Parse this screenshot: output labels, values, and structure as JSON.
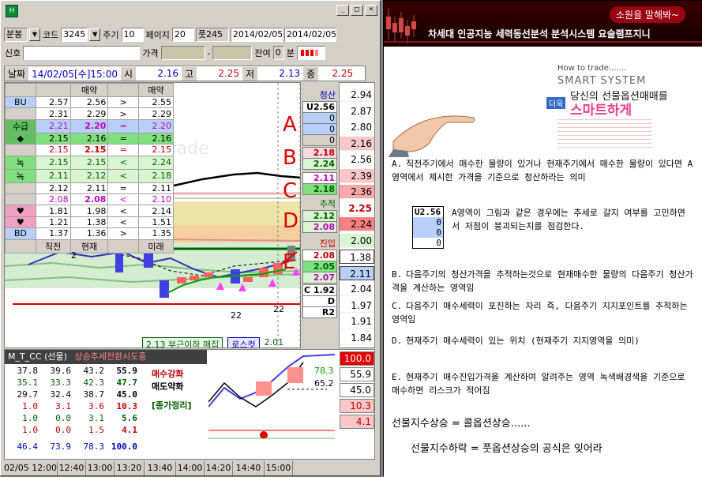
{
  "window": {
    "sys_icon": "H"
  },
  "toolbar": {
    "period_type": "분봉",
    "code_label": "코드",
    "code_value": "3245",
    "cycle_label": "주기",
    "cycle_value": "10",
    "page_label": "페이지",
    "page_value": "20",
    "extra_value": "풋245",
    "date_from": "2014/02/05",
    "date_to": "2014/02/05",
    "signal_label": "신호",
    "price_label": "가격",
    "remain_label": "잔여",
    "remain_value": "0",
    "min_label": "분"
  },
  "quote": {
    "date_label": "날짜",
    "date": "14/02/05[수]15:00",
    "open_label": "시",
    "open": "2.16",
    "high_label": "고",
    "high": "2.25",
    "low_label": "저",
    "low": "2.13",
    "close_label": "종",
    "close": "2.25"
  },
  "orderbook": {
    "header": [
      "",
      "매약",
      "",
      "매약"
    ],
    "rows": [
      {
        "label": "BU",
        "a": "2.57",
        "b": "2.56",
        "s": ">",
        "c": "2.55"
      },
      {
        "label": "",
        "a": "2.31",
        "b": "2.29",
        "s": ">",
        "c": "2.29"
      },
      {
        "label": "수급",
        "a": "2.21",
        "b": "2.20",
        "s": "=",
        "c": "2.20"
      },
      {
        "label": "◆",
        "a": "2.15",
        "b": "2.16",
        "s": "=",
        "c": "2.16"
      },
      {
        "label": "",
        "a": "2.15",
        "b": "2.15",
        "s": "=",
        "c": "2.15"
      },
      {
        "label": "녹",
        "a": "2.15",
        "b": "2.15",
        "s": "<",
        "c": "2.24"
      },
      {
        "label": "녹",
        "a": "2.11",
        "b": "2.12",
        "s": "<",
        "c": "2.18"
      },
      {
        "label": "",
        "a": "2.12",
        "b": "2.11",
        "s": "=",
        "c": "2.11"
      },
      {
        "label": "",
        "a": "2.08",
        "b": "2.08",
        "s": "<",
        "c": "2.10"
      },
      {
        "label": "♥",
        "a": "1.81",
        "b": "1.98",
        "s": "<",
        "c": "2.14"
      },
      {
        "label": "♥",
        "a": "1.21",
        "b": "1.38",
        "s": "<",
        "c": "1.51"
      },
      {
        "label": "BD",
        "a": "1.37",
        "b": "1.36",
        "s": ">",
        "c": "1.35"
      }
    ],
    "footer": [
      "",
      "직전",
      "현재",
      "미래"
    ]
  },
  "annotations": {
    "letters": [
      "A",
      "B",
      "C",
      "D",
      "E"
    ],
    "num_2": "2",
    "num_22a": "22",
    "num_22b": "22"
  },
  "side": {
    "exit_label": "청산",
    "u_label": "U2.56",
    "zeros": [
      "0",
      "0",
      "0",
      "0"
    ],
    "b_values": [
      "2.18",
      "2.24"
    ],
    "c_values": [
      "2.11",
      "2.18"
    ],
    "track_label": "추적",
    "d_values": [
      "2.12",
      "2.08"
    ],
    "entry_label": "진입",
    "e_values": [
      "2.08",
      "2.05",
      "2.07"
    ],
    "c_line": "C 1.92",
    "d_line": "D 1.38",
    "r2": "R2"
  },
  "prices": [
    "2.94",
    "2.87",
    "2.80",
    "2.16",
    "2.56",
    "2.39",
    "2.36",
    "2.25",
    "2.24",
    "2.00",
    "1.38",
    "2.11",
    "2.04",
    "1.97",
    "1.91",
    "1.84"
  ],
  "chart_status": {
    "buy_text": "2.13 부근이하 매집",
    "losscut_label": "로스컷",
    "losscut_value": "2.01"
  },
  "lower": {
    "title": "M_T_CC (선물)",
    "trend": "상승추세전환시도중",
    "rows": [
      [
        "37.8",
        "39.6",
        "43.2",
        "55.9"
      ],
      [
        "35.1",
        "33.3",
        "42.3",
        "47.7"
      ],
      [
        "29.7",
        "32.4",
        "38.7",
        "45.0"
      ],
      [
        "1.0",
        "3.1",
        "3.6",
        "10.3"
      ],
      [
        "1.0",
        "0.0",
        "3.1",
        "5.6"
      ],
      [
        "1.0",
        "0.0",
        "1.5",
        "4.1"
      ],
      [
        "46.4",
        "73.9",
        "78.3",
        "100.0"
      ]
    ],
    "buy_strong": "매수강화",
    "sell_weak": "매도약화",
    "summary": "[종가정리]",
    "mini_values": [
      "78.3",
      "65.2"
    ],
    "right_values": [
      "100.0",
      "55.9",
      "45.0",
      "10.3",
      "4.1"
    ]
  },
  "time_axis": [
    "02/05 12:00",
    "12:40",
    "13:00",
    "13:20",
    "13:40",
    "14:00",
    "14:20",
    "14:40",
    "15:00"
  ],
  "ad": {
    "header_pill": "소원을 말해봐~",
    "header_title": "차세대 인공지능 세력동선분석 분석시스템 요술램프지니",
    "logo_top": "How to trade.......",
    "logo_smart": "SMART SYSTEM",
    "logo_line": "당신의 선물옵션매매를",
    "logo_badge": "더욱",
    "logo_smart2": "스마트하게",
    "paragraphs": [
      {
        "key": "A.",
        "text": "직전주기에서 매수한 물량이 있거나 현재주기에서 매수한 물량이 있다면 A영역에서 제시한 가격을 기준으로 청산하라는 의미"
      },
      {
        "key": "B.",
        "text": "다음주기의 청산가격을 추적하는것으로 현재매수한 물량의 다음주기 청산가격을 계산하는 영역임"
      },
      {
        "key": "C.",
        "text": "다음주기 매수세력이 포진하는 자리 즉, 다음주기 지지포인트를 추적하는 영역임"
      },
      {
        "key": "D.",
        "text": "현재주기 매수세력이 있는 위치 (현재주기 지지영역을 의미)"
      },
      {
        "key": "E.",
        "text": "현재주기 매수진입가격을 계산하여 알려주는 영역 녹색배경색을 기준으로 매수하면 리스크가 적어짐"
      }
    ],
    "note_box": [
      "U2.56",
      "0",
      "0",
      "0"
    ],
    "note_text": "A영역이 그림과 같은 경우에는 추세로 갈지 여부를 고민하면서 저점이 붕괴되는지를 점검한다.",
    "formula1": "선물지수상승 = 콜옵션상승......",
    "formula2": "선물지수하락 = 풋옵션상승의 공식은 잊어라"
  }
}
